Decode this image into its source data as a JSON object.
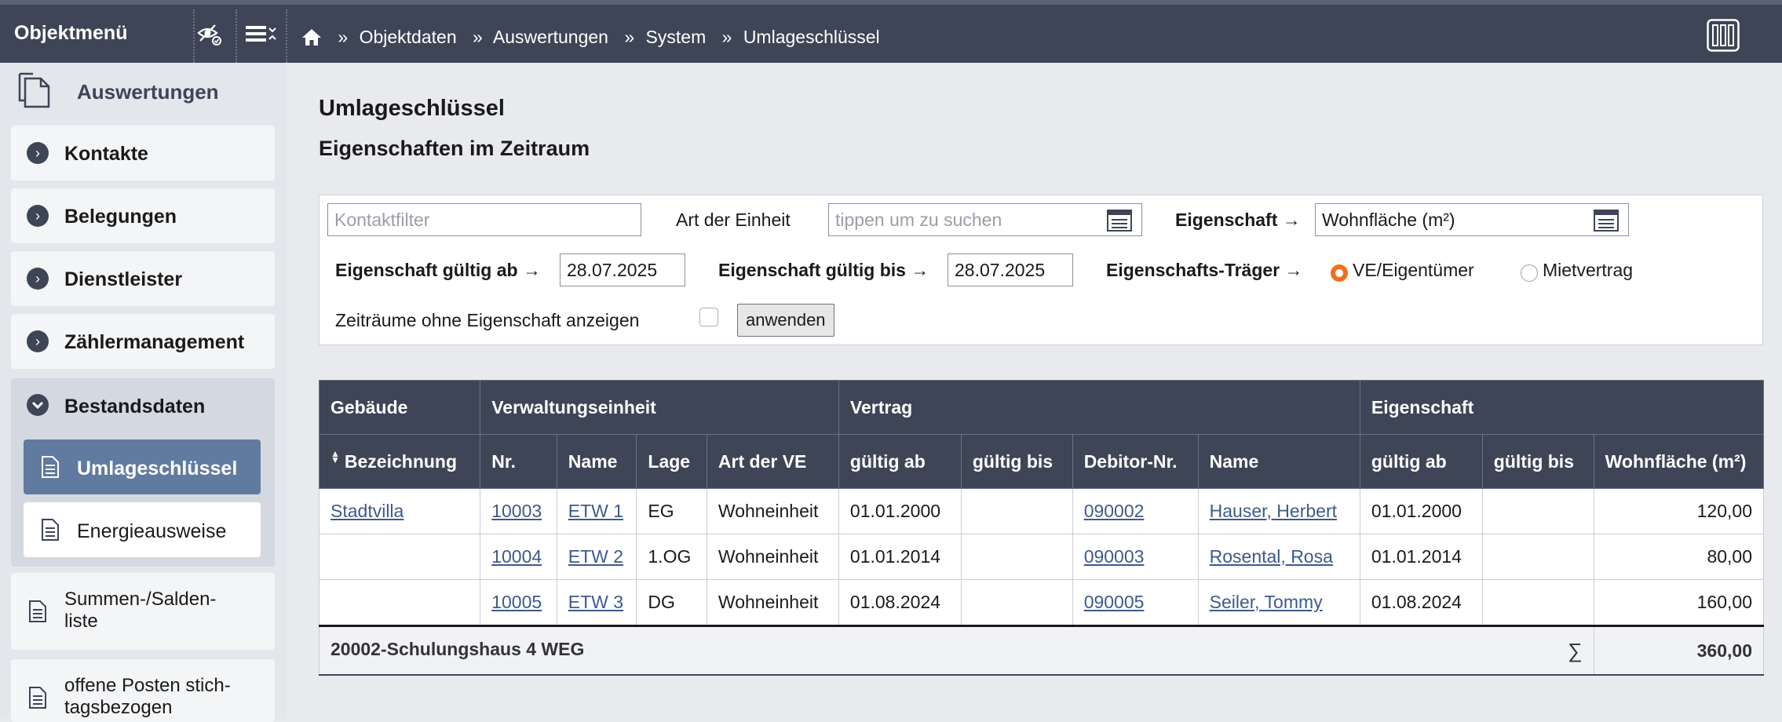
{
  "topbar": {
    "title": "Objektmenü",
    "breadcrumb": [
      "Objektdaten",
      "Auswertungen",
      "System",
      "Umlageschlüssel"
    ],
    "breadcrumb_separator": "»"
  },
  "sidebar": {
    "header": "Auswertungen",
    "items": [
      {
        "label": "Kontakte"
      },
      {
        "label": "Belegungen"
      },
      {
        "label": "Dienstleister"
      },
      {
        "label": "Zählermanagement"
      },
      {
        "label": "Bestandsdaten"
      }
    ],
    "sub_items": [
      {
        "label": "Umlageschlüssel",
        "active": true
      },
      {
        "label": "Energieausweise",
        "active": false
      }
    ],
    "doc_items": [
      {
        "line1": "Summen-/Salden-",
        "line2": "liste"
      },
      {
        "line1": "offene Posten stich-",
        "line2": "tagsbezogen"
      }
    ]
  },
  "main": {
    "title": "Umlageschlüssel",
    "subtitle": "Eigenschaften im Zeitraum"
  },
  "filter": {
    "contact_placeholder": "Kontaktfilter",
    "unit_type_label": "Art der Einheit",
    "unit_type_placeholder": "tippen um zu suchen",
    "property_label": "Eigenschaft",
    "property_value": "Wohnfläche (m²)",
    "valid_from_label": "Eigenschaft gültig ab",
    "valid_from_value": "28.07.2025",
    "valid_to_label": "Eigenschaft gültig bis",
    "valid_to_value": "28.07.2025",
    "carrier_label": "Eigenschafts-Träger",
    "carrier_options": [
      "VE/Eigentümer",
      "Mietvertrag"
    ],
    "carrier_selected": "VE/Eigentümer",
    "show_empty_label": "Zeiträume ohne Eigenschaft anzeigen",
    "show_empty_checked": false,
    "apply_label": "anwenden",
    "arrow": "→"
  },
  "table": {
    "groups": [
      {
        "label": "Gebäude"
      },
      {
        "label": "Verwaltungseinheit"
      },
      {
        "label": "Vertrag"
      },
      {
        "label": "Eigenschaft"
      }
    ],
    "columns": [
      "Bezeichnung",
      "Nr.",
      "Name",
      "Lage",
      "Art der VE",
      "gültig ab",
      "gültig bis",
      "Debitor-Nr.",
      "Name",
      "gültig ab",
      "gültig bis",
      "Wohnfläche (m²)"
    ],
    "rows": [
      {
        "building": "Stadtvilla",
        "nr": "10003",
        "name": "ETW 1",
        "lage": "EG",
        "art": "Wohneinheit",
        "v_from": "01.01.2000",
        "v_to": "",
        "debitor": "090002",
        "tenant": "Hauser, Herbert",
        "p_from": "01.01.2000",
        "p_to": "",
        "value": "120,00"
      },
      {
        "building": "",
        "nr": "10004",
        "name": "ETW 2",
        "lage": "1.OG",
        "art": "Wohneinheit",
        "v_from": "01.01.2014",
        "v_to": "",
        "debitor": "090003",
        "tenant": "Rosental, Rosa",
        "p_from": "01.01.2014",
        "p_to": "",
        "value": "80,00"
      },
      {
        "building": "",
        "nr": "10005",
        "name": "ETW 3",
        "lage": "DG",
        "art": "Wohneinheit",
        "v_from": "01.08.2024",
        "v_to": "",
        "debitor": "090005",
        "tenant": "Seiler, Tommy",
        "p_from": "01.08.2024",
        "p_to": "",
        "value": "160,00"
      }
    ],
    "footer": {
      "label": "20002-Schulungshaus 4 WEG",
      "sum_symbol": "∑",
      "total": "360,00"
    }
  },
  "colors": {
    "topbar": "#3d4556",
    "active_item": "#617aa0",
    "radio_selected": "#f07020",
    "link": "#3d5a8a"
  }
}
